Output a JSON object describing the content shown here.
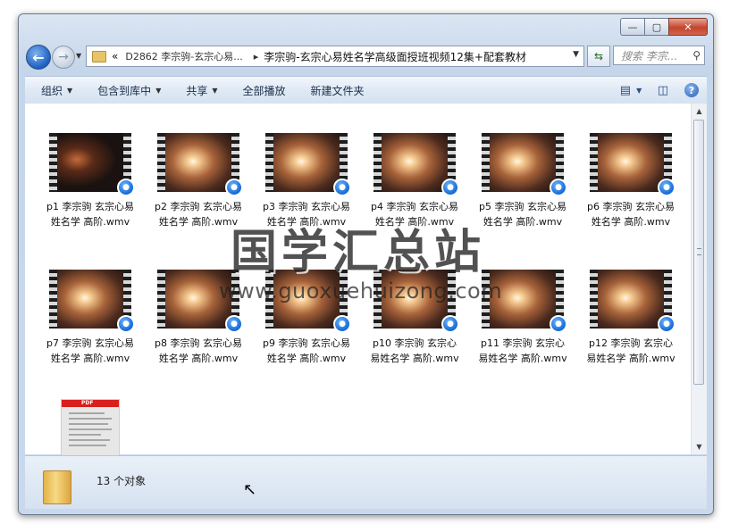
{
  "window": {
    "min": "—",
    "max": "▢",
    "close": "✕"
  },
  "address": {
    "chevrons": "«",
    "crumb1": "D2862 李宗驹-玄宗心易...",
    "sep": "▸",
    "crumb2": "李宗驹-玄宗心易姓名学高级面授班视频12集+配套教材",
    "search_placeholder": "搜索 李宗..."
  },
  "toolbar": {
    "organize": "组织",
    "include_library": "包含到库中",
    "share": "共享",
    "play_all": "全部播放",
    "new_folder": "新建文件夹"
  },
  "files": [
    {
      "name": "p1 李宗驹 玄宗心易姓名学 高阶.wmv"
    },
    {
      "name": "p2 李宗驹 玄宗心易姓名学 高阶.wmv"
    },
    {
      "name": "p3 李宗驹 玄宗心易姓名学 高阶.wmv"
    },
    {
      "name": "p4 李宗驹 玄宗心易姓名学 高阶.wmv"
    },
    {
      "name": "p5 李宗驹 玄宗心易姓名学 高阶.wmv"
    },
    {
      "name": "p6 李宗驹 玄宗心易姓名学 高阶.wmv"
    },
    {
      "name": "p7 李宗驹 玄宗心易姓名学 高阶.wmv"
    },
    {
      "name": "p8 李宗驹 玄宗心易姓名学 高阶.wmv"
    },
    {
      "name": "p9 李宗驹 玄宗心易姓名学 高阶.wmv"
    },
    {
      "name": "p10 李宗驹 玄宗心易姓名学 高阶.wmv"
    },
    {
      "name": "p11 李宗驹 玄宗心易姓名学 高阶.wmv"
    },
    {
      "name": "p12 李宗驹 玄宗心易姓名学 高阶.wmv"
    }
  ],
  "pdf_badge": "PDF",
  "watermark": {
    "cn": "国学汇总站",
    "url": "www.guoxuehuizong.com"
  },
  "status": {
    "count": "13 个对象"
  }
}
